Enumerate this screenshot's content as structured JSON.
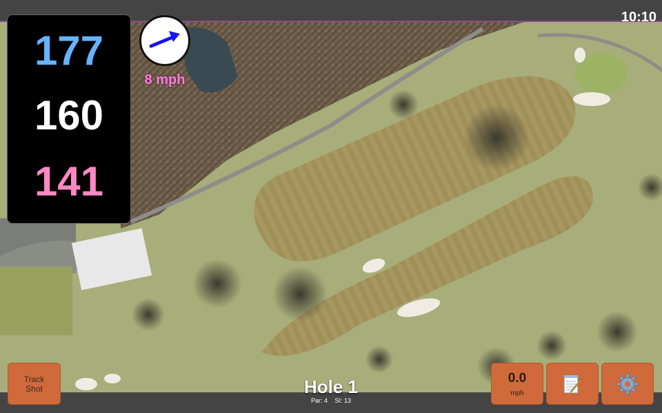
{
  "status": {
    "clock": "10:10"
  },
  "yardages": {
    "back": "177",
    "middle": "160",
    "front": "141"
  },
  "wind": {
    "speed_label": "8 mph",
    "direction_icon": "wind-arrow-icon"
  },
  "buttons": {
    "track_shot": "Track\nShot",
    "speed_value": "0.0",
    "speed_unit": "mph",
    "notes_icon": "notepad-icon",
    "settings_icon": "gear-icon"
  },
  "hole": {
    "title": "Hole 1",
    "par": "Par: 4",
    "si": "SI: 13"
  },
  "colors": {
    "back_yardage": "#66b3ff",
    "middle_yardage": "#ffffff",
    "front_yardage": "#ff88c4",
    "wind_text": "#ff7fd8",
    "button": "#d06a3a",
    "bar": "#444444"
  }
}
